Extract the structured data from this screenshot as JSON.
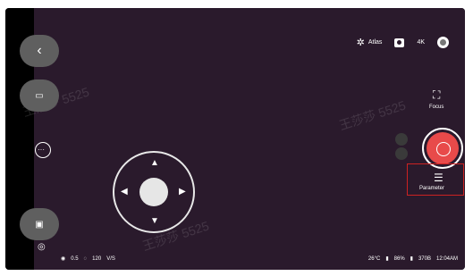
{
  "top": {
    "atlas_label": "Atlas",
    "resolution_label": "4K"
  },
  "right": {
    "focus_label": "Focus",
    "parameter_label": "Parameter"
  },
  "bottom": {
    "left_values": {
      "aperture": "0.5",
      "iso": "120",
      "mode": "V/S"
    },
    "right_values": {
      "temperature": "26°C",
      "battery": "86%",
      "storage": "370B",
      "time": "12:04AM"
    }
  },
  "watermark_text": "王莎莎 5525",
  "colors": {
    "screen_bg": "#2a1a2c",
    "shutter": "#e84a4a",
    "highlight": "#cc2222"
  }
}
